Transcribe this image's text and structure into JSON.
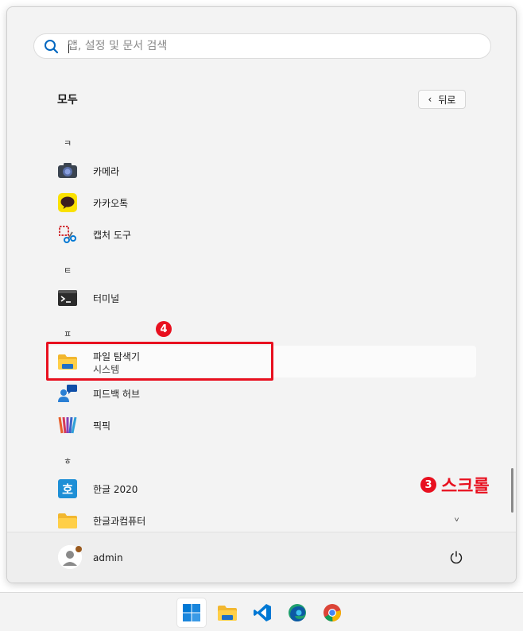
{
  "search": {
    "placeholder": "앱, 설정 및 문서 검색"
  },
  "header": {
    "title": "모두",
    "back_label": "뒤로"
  },
  "groups": [
    {
      "letter": "ㅋ",
      "apps": [
        {
          "name": "카메라",
          "icon": "camera-icon"
        },
        {
          "name": "카카오톡",
          "icon": "kakaotalk-icon"
        },
        {
          "name": "캡처 도구",
          "icon": "snipping-tool-icon"
        }
      ]
    },
    {
      "letter": "ㅌ",
      "apps": [
        {
          "name": "터미널",
          "icon": "terminal-icon"
        }
      ]
    },
    {
      "letter": "ㅍ",
      "apps": [
        {
          "name": "파일 탐색기",
          "subtitle": "시스템",
          "icon": "file-explorer-icon"
        },
        {
          "name": "피드백 허브",
          "icon": "feedback-hub-icon"
        },
        {
          "name": "픽픽",
          "icon": "picpick-icon"
        }
      ]
    },
    {
      "letter": "ㅎ",
      "apps": [
        {
          "name": "한글 2020",
          "icon": "hangul-icon"
        },
        {
          "name": "한글과컴퓨터",
          "icon": "folder-icon"
        }
      ]
    }
  ],
  "annotations": {
    "badge_select": "4",
    "badge_scroll": "3",
    "scroll_label": "스크롤"
  },
  "user": {
    "name": "admin"
  },
  "taskbar": [
    "start-icon",
    "file-explorer-icon",
    "vscode-icon",
    "edge-icon",
    "chrome-icon"
  ],
  "colors": {
    "accent": "#0067c0",
    "annotation": "#e8101f"
  }
}
